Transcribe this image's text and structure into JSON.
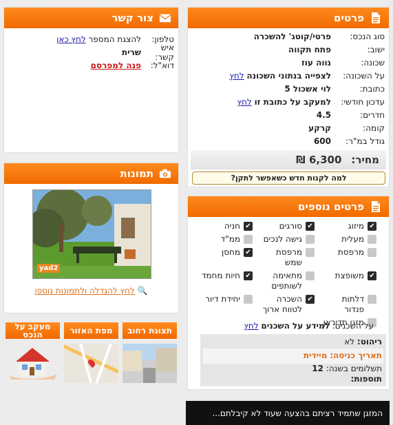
{
  "details": {
    "title": "פרטים",
    "rows": [
      {
        "label": "סוג הנכס:",
        "value": "פרטי/קוטג' להשכרה"
      },
      {
        "label": "ישוב:",
        "value": "פתח תקווה"
      },
      {
        "label": "שכונה:",
        "value": "נווה עוז"
      },
      {
        "label": "על השכונה:",
        "value": "לצפייה בנתוני השכונה",
        "link": "לחץ"
      },
      {
        "label": "כתובת:",
        "value": "לוי אשכול 5"
      },
      {
        "label": "עדכון חודשי:",
        "value": "למעקב על כתובת זו",
        "link": "לחץ"
      },
      {
        "label": "חדרים:",
        "value": "4.5"
      },
      {
        "label": "קומה:",
        "value": "קרקע"
      },
      {
        "label": "גודל במ\"ר:",
        "value": "600"
      }
    ],
    "price_label": "מחיר:",
    "price_value": "6,300 ₪",
    "new_account_text": "למה לקנות חדש כשאפשר לתקן?"
  },
  "contact": {
    "title": "צור קשר",
    "phone_label": "טלפון:",
    "phone_text": "להצגת המספר",
    "phone_link": "לחץ כאן",
    "person_label": "איש קשר:",
    "person_value": "שרית",
    "email_label": "דוא\"ל:",
    "email_link": "פנה למפרסם"
  },
  "photos": {
    "title": "תמונות",
    "watermark": "yad2",
    "enlarge_link": "לחץ להגדלה ולתמונות נוספו"
  },
  "extra": {
    "title": "פרטים נוספים",
    "features": [
      {
        "label": "מיזוג",
        "checked": true
      },
      {
        "label": "סורגים",
        "checked": true
      },
      {
        "label": "חניה",
        "checked": true
      },
      {
        "label": "מעלית",
        "checked": false
      },
      {
        "label": "גישה לנכים",
        "checked": false
      },
      {
        "label": "ממ\"ד",
        "checked": false
      },
      {
        "label": "מרפסת",
        "checked": false
      },
      {
        "label": "מרפסת שמש",
        "checked": false
      },
      {
        "label": "מחסן",
        "checked": true
      },
      {
        "label": "משופצת",
        "checked": true
      },
      {
        "label": "מתאימה לשותפים",
        "checked": false
      },
      {
        "label": "חיות מחמד",
        "checked": true
      },
      {
        "label": "דלתות פנדור",
        "checked": false
      },
      {
        "label": "השכרה לטווח ארוך",
        "checked": true
      },
      {
        "label": "יחידת דיור",
        "checked": false
      },
      {
        "label": "מזגן תדיראן",
        "checked": false
      }
    ],
    "neighbors_label": "על השכנים:",
    "neighbors_value": "למידע על השכנים",
    "neighbors_link": "לחץ",
    "furniture_label": "ריהוט:",
    "furniture_value": "לא",
    "entry_label": "תאריך כניסה:",
    "entry_value": "מיידית",
    "payments_label": "תשלומים בשנה:",
    "payments_value": "12",
    "additions_label": "תוספות:"
  },
  "tiles": {
    "street": "תצוגת רחוב",
    "map": "מפת האזור",
    "track": "מעקב על הנכס"
  },
  "banner": {
    "text": "המזגן שתמיד רציתם  בהצעה שעוד לא קיבלתם..."
  },
  "colors": {
    "accent": "#f47a0c",
    "banner": "#111111",
    "entry": "#e0701c"
  }
}
